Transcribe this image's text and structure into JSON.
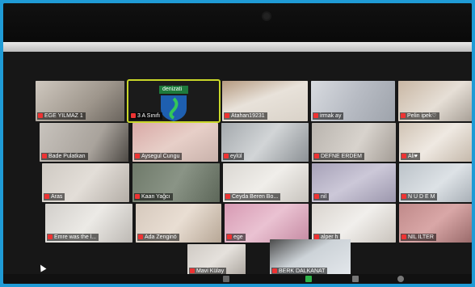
{
  "meeting": {
    "logo_text": "denizati",
    "tiles": [
      {
        "name": "EGE YILMAZ 1"
      },
      {
        "name": "3 A Sınıfı"
      },
      {
        "name": "Atahan19231"
      },
      {
        "name": "irmak ay"
      },
      {
        "name": "Pelin ipek♡"
      },
      {
        "name": "Bade Pulatkan"
      },
      {
        "name": "Aysegul Cungu"
      },
      {
        "name": "eylül"
      },
      {
        "name": "DEFNE ERDEM"
      },
      {
        "name": "Ali♥"
      },
      {
        "name": "Aras"
      },
      {
        "name": "Kaan Yağcı"
      },
      {
        "name": "Ceyda Beren Bo..."
      },
      {
        "name": "nil"
      },
      {
        "name": "N U D E M"
      },
      {
        "name": "Emre was the l..."
      },
      {
        "name": "Ada Zenginö"
      },
      {
        "name": "ege"
      },
      {
        "name": "alper h"
      },
      {
        "name": "NİL İLTER"
      },
      {
        "name": "Mavi Külay"
      },
      {
        "name": "BERK DALKANAT"
      }
    ]
  },
  "colors": {
    "active_border": "#c9d72a",
    "mic_muted": "#e33333",
    "page_border": "#1f9bd6"
  }
}
